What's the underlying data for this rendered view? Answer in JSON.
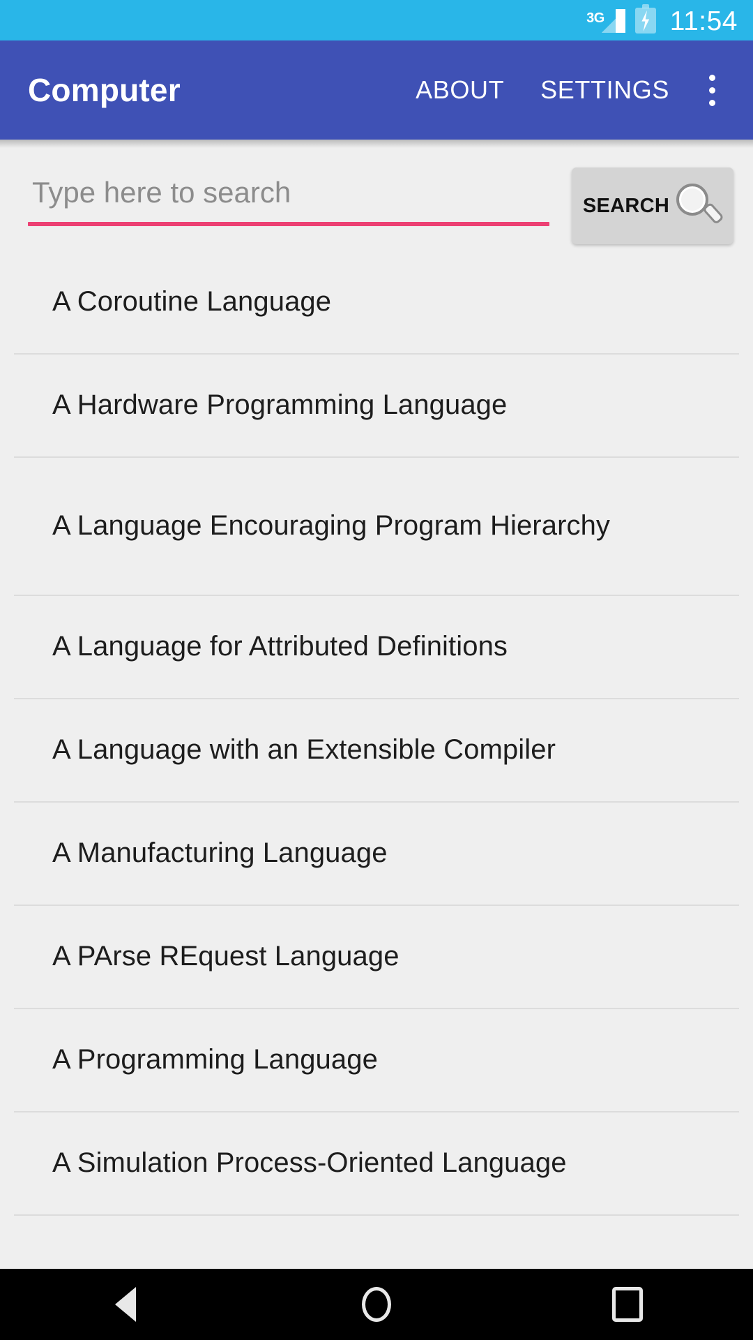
{
  "status_bar": {
    "network_type": "3G",
    "time": "11:54",
    "background_color": "#29B6E8",
    "icons": [
      "signal-icon",
      "battery-charging-icon"
    ]
  },
  "app_bar": {
    "title": "Computer",
    "background_color": "#3F51B5",
    "actions": [
      {
        "label": "ABOUT",
        "name": "about"
      },
      {
        "label": "SETTINGS",
        "name": "settings"
      }
    ],
    "overflow_icon": "overflow-menu-icon"
  },
  "search": {
    "placeholder": "Type here to search",
    "value": "",
    "underline_color": "#EC4073",
    "button_label": "SEARCH",
    "button_icon": "magnifier-icon",
    "button_color": "#D4D4D4"
  },
  "results": [
    {
      "title": "A Coroutine Language",
      "lines": 1
    },
    {
      "title": "A Hardware Programming Language",
      "lines": 1
    },
    {
      "title": "A Language Encouraging Program Hierarchy",
      "lines": 2
    },
    {
      "title": "A Language for Attributed Definitions",
      "lines": 1
    },
    {
      "title": "A Language with an Extensible Compiler",
      "lines": 1
    },
    {
      "title": "A Manufacturing Language",
      "lines": 1
    },
    {
      "title": "A PArse REquest Language",
      "lines": 1
    },
    {
      "title": "A Programming Language",
      "lines": 1
    },
    {
      "title": "A Simulation Process-Oriented Language",
      "lines": 1
    }
  ],
  "nav_bar": {
    "background_color": "#000000",
    "buttons": [
      {
        "name": "back",
        "icon": "triangle-back-icon"
      },
      {
        "name": "home",
        "icon": "circle-home-icon"
      },
      {
        "name": "recents",
        "icon": "square-recents-icon"
      }
    ]
  }
}
